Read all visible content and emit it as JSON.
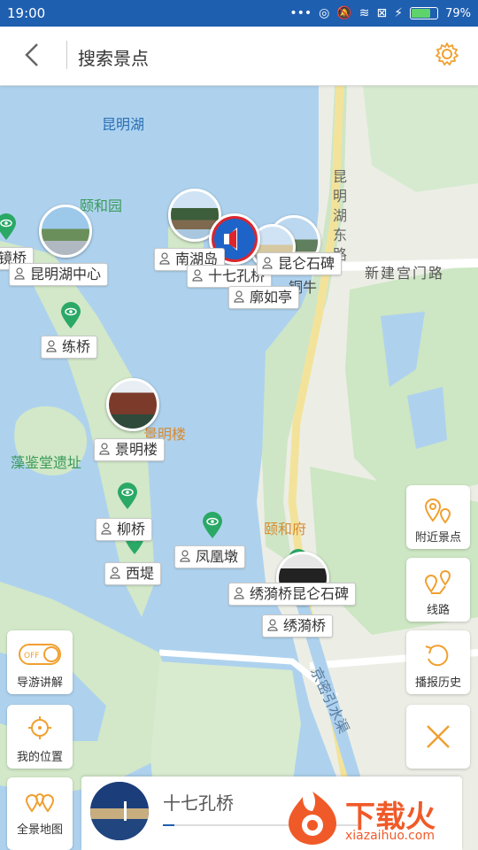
{
  "status_bar": {
    "time": "19:00",
    "battery": "79%",
    "battery_level": 0.79
  },
  "header": {
    "title": "搜索景点"
  },
  "map": {
    "labels": {
      "kunming_lake": "昆明湖",
      "yiheyuan_park": "颐和园",
      "yiheyuan_road": "颐和府",
      "kunming_east_road": "昆明湖东路",
      "xinjiangong_road": "新建宫门路",
      "jingming_building": "景明楼",
      "zaojiantang": "藻鉴堂遗址",
      "jingmi_canal": "京密引水渠",
      "tongniu": "铜牛"
    },
    "pois": [
      "镜桥",
      "昆明湖中心",
      "南湖岛",
      "十七孔桥",
      "昆仑石碑",
      "廓如亭",
      "练桥",
      "景明楼",
      "柳桥",
      "西堤",
      "凤凰墩",
      "绣漪桥昆仑石碑",
      "绣漪桥"
    ]
  },
  "side_buttons": {
    "nearby": "附近景点",
    "route": "线路",
    "history": "播报历史",
    "guide": "导游讲解",
    "guide_toggle": "OFF",
    "my_location": "我的位置",
    "overview": "全景地图"
  },
  "player": {
    "title": "十七孔桥",
    "progress": 0.06
  },
  "watermark": {
    "brand": "下载火",
    "site": "xiazaihuo.com"
  },
  "colors": {
    "accent": "#1f5fb0",
    "orange": "#f0a030",
    "water": "#aed2ee",
    "pin_green": "#2aa866"
  }
}
